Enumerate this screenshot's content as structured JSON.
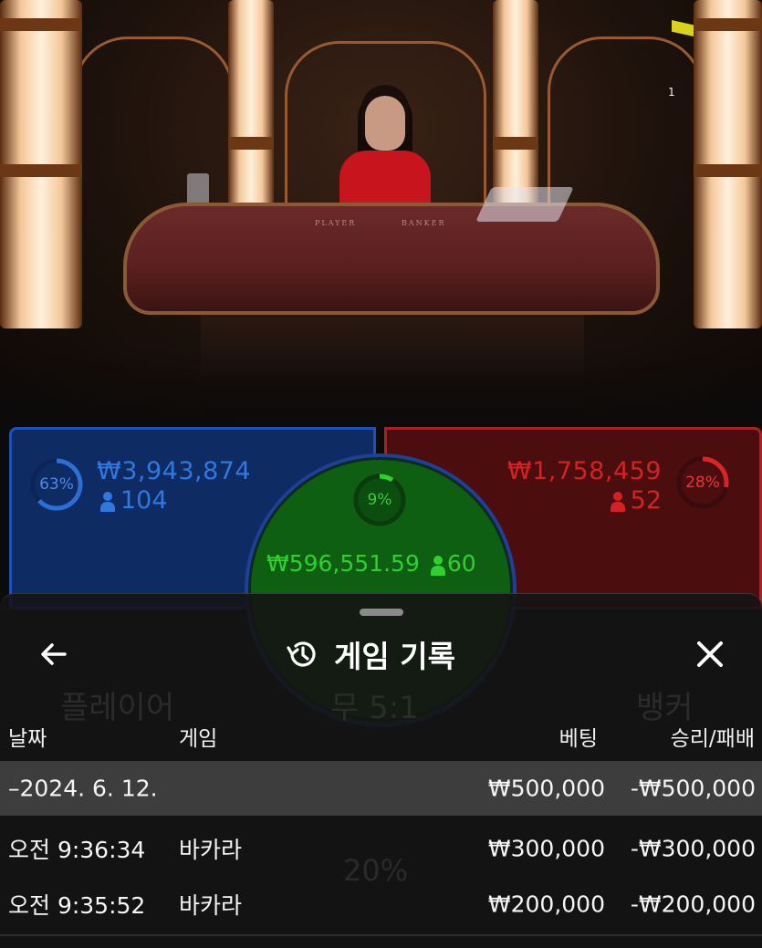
{
  "video": {
    "table_labels": {
      "player": "PLAYER",
      "banker": "BANKER"
    },
    "flag_number": "1"
  },
  "betting": {
    "player": {
      "percent": "63%",
      "percent_value": 0.63,
      "amount": "₩3,943,874",
      "count": "104",
      "color": "#2a6fd6"
    },
    "tie": {
      "percent": "9%",
      "percent_value": 0.09,
      "amount": "₩596,551.59",
      "count": "60",
      "color": "#2fd02f"
    },
    "banker": {
      "percent": "28%",
      "percent_value": 0.28,
      "amount": "₩1,758,459",
      "count": "52",
      "color": "#d82626"
    }
  },
  "sheet": {
    "title": "게임 기록",
    "back_icon": "arrow-left-icon",
    "history_icon": "history-icon",
    "close_icon": "close-icon",
    "ghost": {
      "player": "플레이어",
      "tie": "무 5:1",
      "banker": "뱅커",
      "tie_percent": "20%"
    },
    "columns": {
      "date": "날짜",
      "game": "게임",
      "bet": "베팅",
      "result": "승리/패배"
    },
    "date_row": {
      "date": "–2024. 6. 12.",
      "bet": "₩500,000",
      "result": "-₩500,000"
    },
    "rows": [
      {
        "time": "오전 9:36:34",
        "game": "바카라",
        "bet": "₩300,000",
        "result": "-₩300,000"
      },
      {
        "time": "오전 9:35:52",
        "game": "바카라",
        "bet": "₩200,000",
        "result": "-₩200,000"
      }
    ]
  }
}
